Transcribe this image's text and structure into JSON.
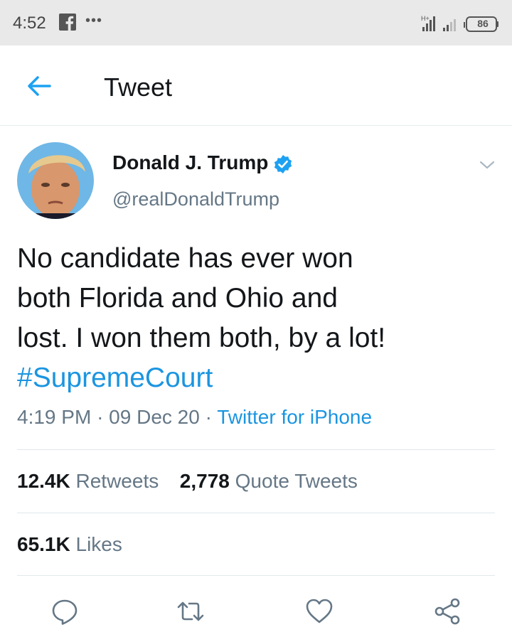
{
  "status_bar": {
    "time": "4:52",
    "more": "•••",
    "battery": "86",
    "icons": [
      "facebook-icon",
      "signal-icon",
      "battery-icon"
    ]
  },
  "header": {
    "title": "Tweet",
    "back_icon": "arrow-left-icon"
  },
  "tweet": {
    "author_name": "Donald J. Trump",
    "handle": "@realDonaldTrump",
    "verified": true,
    "text_lines": [
      "No candidate has ever won",
      "both Florida and Ohio and",
      "lost. I won them both, by a lot!"
    ],
    "hashtag": "#SupremeCourt",
    "time": "4:19 PM",
    "date": "09 Dec 20",
    "separator": "·",
    "source": "Twitter for iPhone"
  },
  "stats": {
    "retweets_count": "12.4K",
    "retweets_label": "Retweets",
    "quote_count": "2,778",
    "quote_label": "Quote Tweets",
    "likes_count": "65.1K",
    "likes_label": "Likes"
  },
  "actions": [
    "reply-icon",
    "retweet-icon",
    "like-icon",
    "share-icon"
  ],
  "colors": {
    "accent": "#1da1f2",
    "link": "#1b95e0",
    "text": "#14171a",
    "secondary": "#657786",
    "divider": "#e1e8ed"
  }
}
